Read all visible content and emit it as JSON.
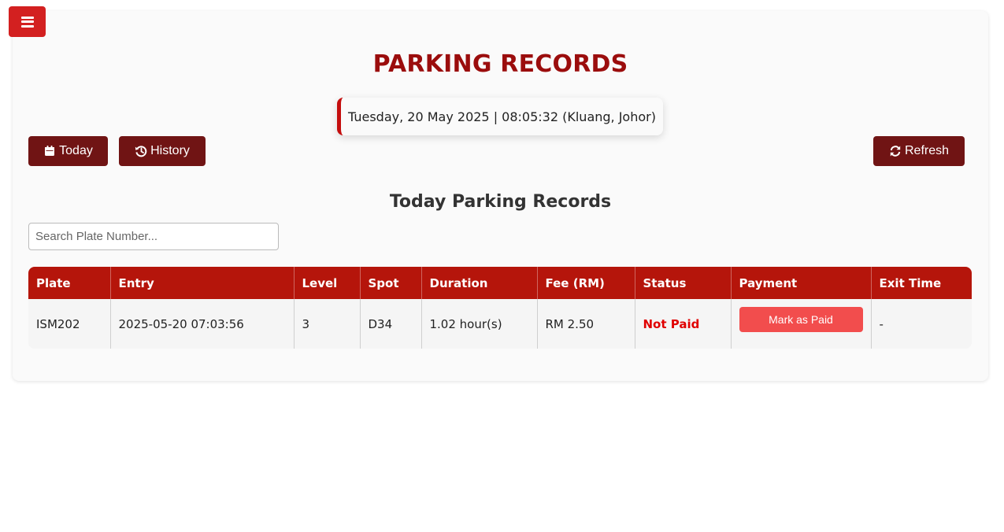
{
  "menu": {
    "icon": "bars-icon"
  },
  "header": {
    "title": "PARKING RECORDS",
    "datetime": "Tuesday, 20 May 2025 | 08:05:32 (Kluang, Johor)"
  },
  "toolbar": {
    "today_label": "Today",
    "today_icon": "calendar-icon",
    "history_label": "History",
    "history_icon": "history-icon",
    "refresh_label": "Refresh",
    "refresh_icon": "refresh-icon"
  },
  "section": {
    "title": "Today Parking Records"
  },
  "search": {
    "placeholder": "Search Plate Number...",
    "value": ""
  },
  "table": {
    "columns": [
      "Plate",
      "Entry",
      "Level",
      "Spot",
      "Duration",
      "Fee (RM)",
      "Status",
      "Payment",
      "Exit Time"
    ],
    "rows": [
      {
        "plate": "ISM202",
        "entry": "2025-05-20 07:03:56",
        "level": "3",
        "spot": "D34",
        "duration": "1.02 hour(s)",
        "fee": "RM 2.50",
        "status": "Not Paid",
        "payment_label": "Mark as Paid",
        "exit_time": "-"
      }
    ]
  },
  "colors": {
    "accent": "#9b0d0d",
    "header_row": "#b5150b",
    "button": "#701414",
    "status_unpaid": "#e00000",
    "pay_button": "#f24d4d"
  }
}
